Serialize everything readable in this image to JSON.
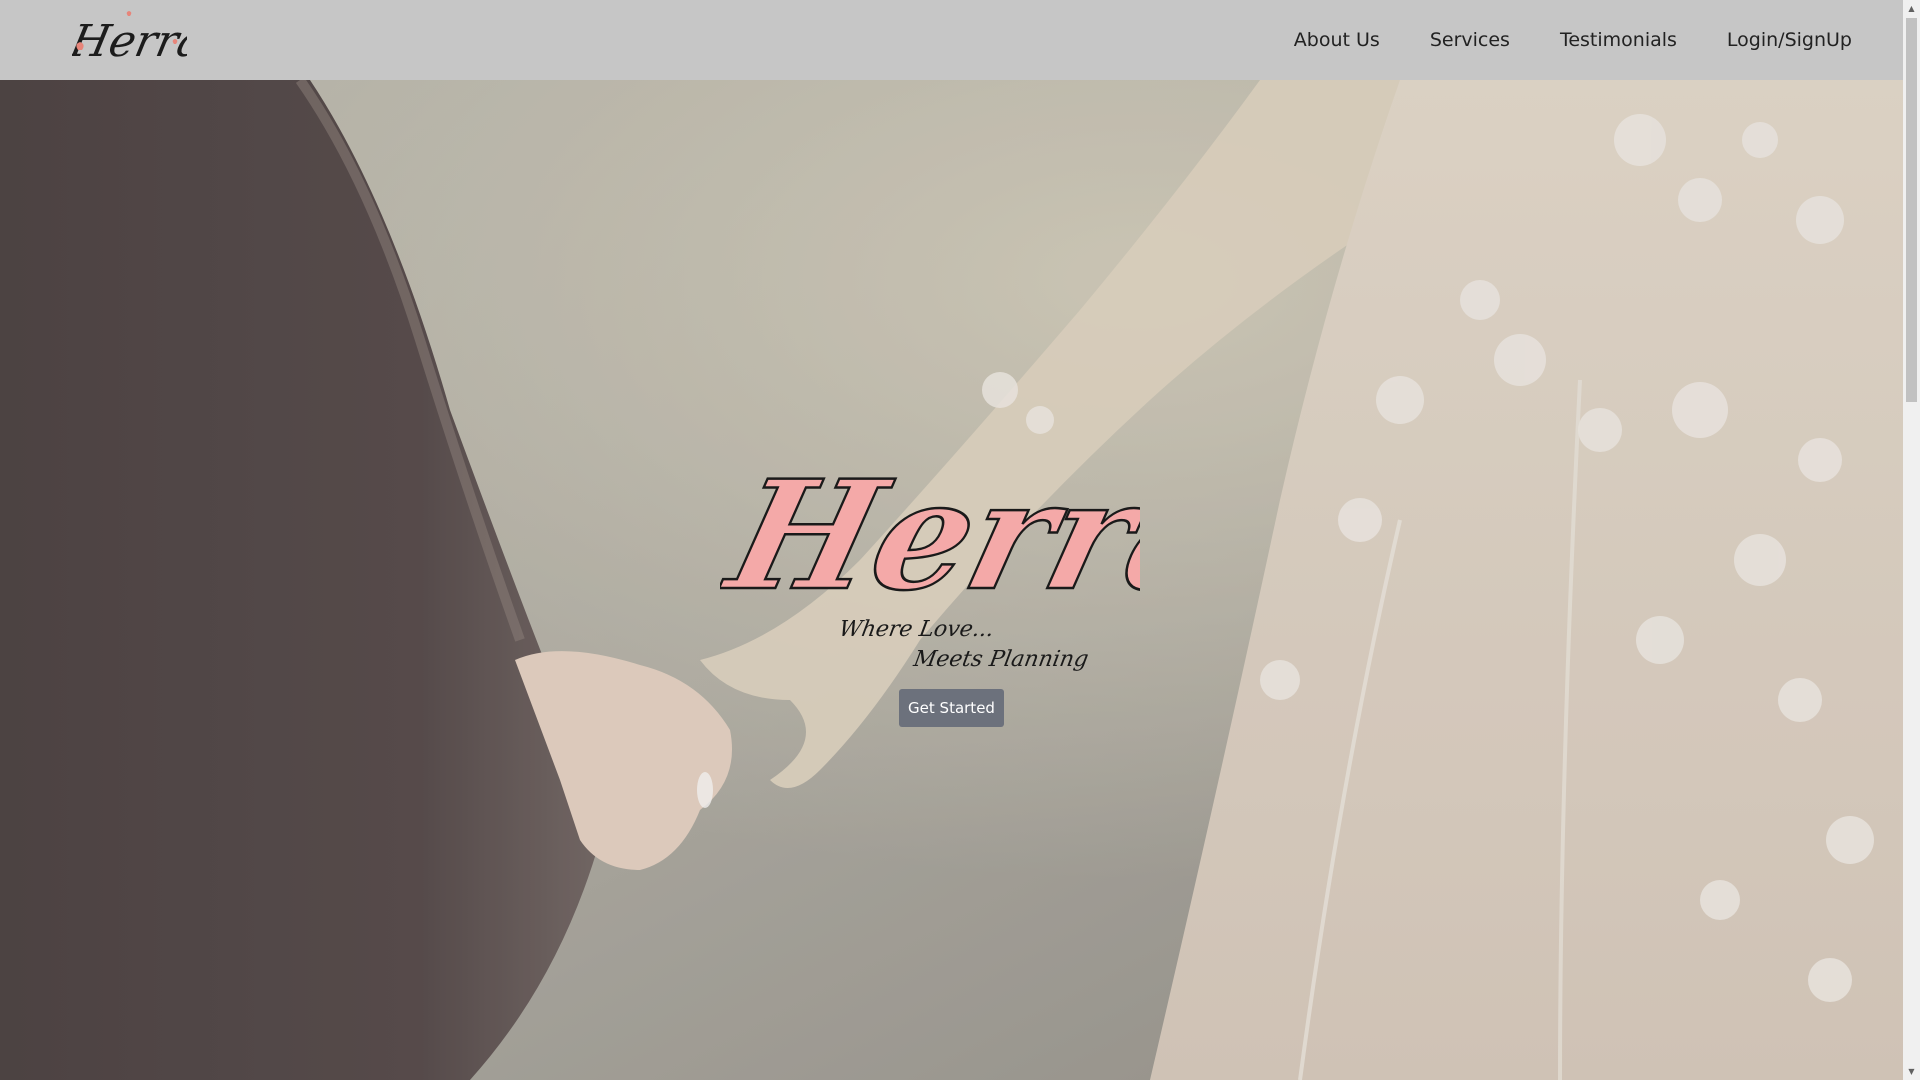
{
  "brand": {
    "name": "Herra",
    "tagline_line1": "Where Love...",
    "tagline_line2": "Meets Planning",
    "accent_color": "#f4a9a8"
  },
  "nav": {
    "items": [
      {
        "label": "About Us"
      },
      {
        "label": "Services"
      },
      {
        "label": "Testimonials"
      },
      {
        "label": "Login/SignUp"
      }
    ]
  },
  "hero": {
    "cta_label": "Get Started"
  },
  "icons": {
    "scroll_up": "scroll-up-arrow-icon",
    "scroll_down": "scroll-down-arrow-icon"
  }
}
